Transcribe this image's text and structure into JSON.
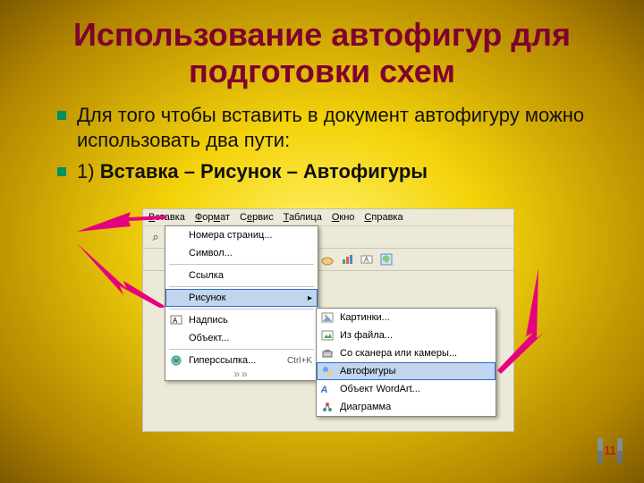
{
  "title": "Использование автофигур для подготовки схем",
  "bullets": [
    "Для того чтобы вставить в документ автофигуру можно использовать два пути:",
    {
      "prefix": "1)",
      "bold": "Вставка – Рисунок – Автофигуры"
    }
  ],
  "word": {
    "menubar": [
      {
        "u": "В",
        "r": "ставка"
      },
      {
        "label": "Формат"
      },
      {
        "label": "Сервис"
      },
      {
        "label": "Таблица"
      },
      {
        "label": "Окно"
      },
      {
        "label": "Справка"
      }
    ],
    "insert_menu": [
      "Номера страниц...",
      "Символ...",
      "Ссылка",
      "Рисунок",
      "Надпись",
      "Объект...",
      "Гиперссылка..."
    ],
    "hyperlink_shortcut": "Ctrl+K",
    "picture_menu": [
      "Картинки...",
      "Из файла...",
      "Со сканера или камеры...",
      "Автофигуры",
      "Объект WordArt...",
      "Диаграмма"
    ]
  },
  "page_number": "11"
}
